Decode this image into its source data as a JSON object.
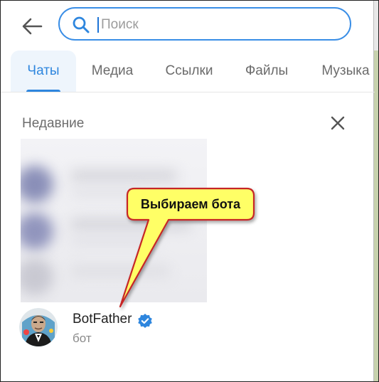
{
  "search": {
    "placeholder": "Поиск"
  },
  "tabs": [
    {
      "label": "Чаты",
      "active": true
    },
    {
      "label": "Медиа",
      "active": false
    },
    {
      "label": "Ссылки",
      "active": false
    },
    {
      "label": "Файлы",
      "active": false
    },
    {
      "label": "Музыка",
      "active": false
    }
  ],
  "recent": {
    "title": "Недавние",
    "bot": {
      "name": "BotFather",
      "subtitle": "бот",
      "verified": true
    }
  },
  "annotation": {
    "text": "Выбираем бота"
  },
  "icons": [
    "back-arrow-icon",
    "search-icon",
    "close-icon",
    "verified-badge-icon"
  ],
  "colors": {
    "accent": "#2e86de",
    "callout_fill": "#ffff66",
    "callout_border": "#c62828"
  }
}
